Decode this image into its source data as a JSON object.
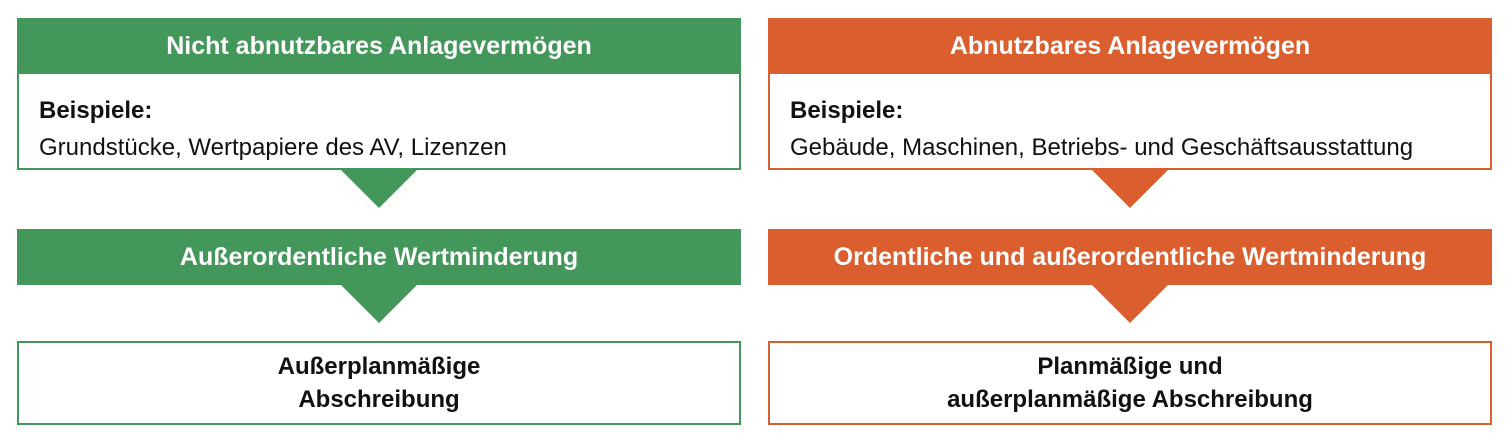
{
  "colors": {
    "left_accent": "#43975a",
    "right_accent": "#db5e2e"
  },
  "left": {
    "header": "Nicht abnutzbares Anlagevermögen",
    "examples_label": "Beispiele:",
    "examples_text": "Grundstücke, Wertpapiere des AV, Lizenzen",
    "reduction": "Außerordentliche Wertminderung",
    "result_line1": "Außerplanmäßige",
    "result_line2": "Abschreibung"
  },
  "right": {
    "header": "Abnutzbares Anlagevermögen",
    "examples_label": "Beispiele:",
    "examples_text": "Gebäude, Maschinen, Betriebs- und Geschäftsausstattung",
    "reduction": "Ordentliche und außerordentliche Wertminderung",
    "result_line1": "Planmäßige und",
    "result_line2": "außerplanmäßige Abschreibung"
  }
}
